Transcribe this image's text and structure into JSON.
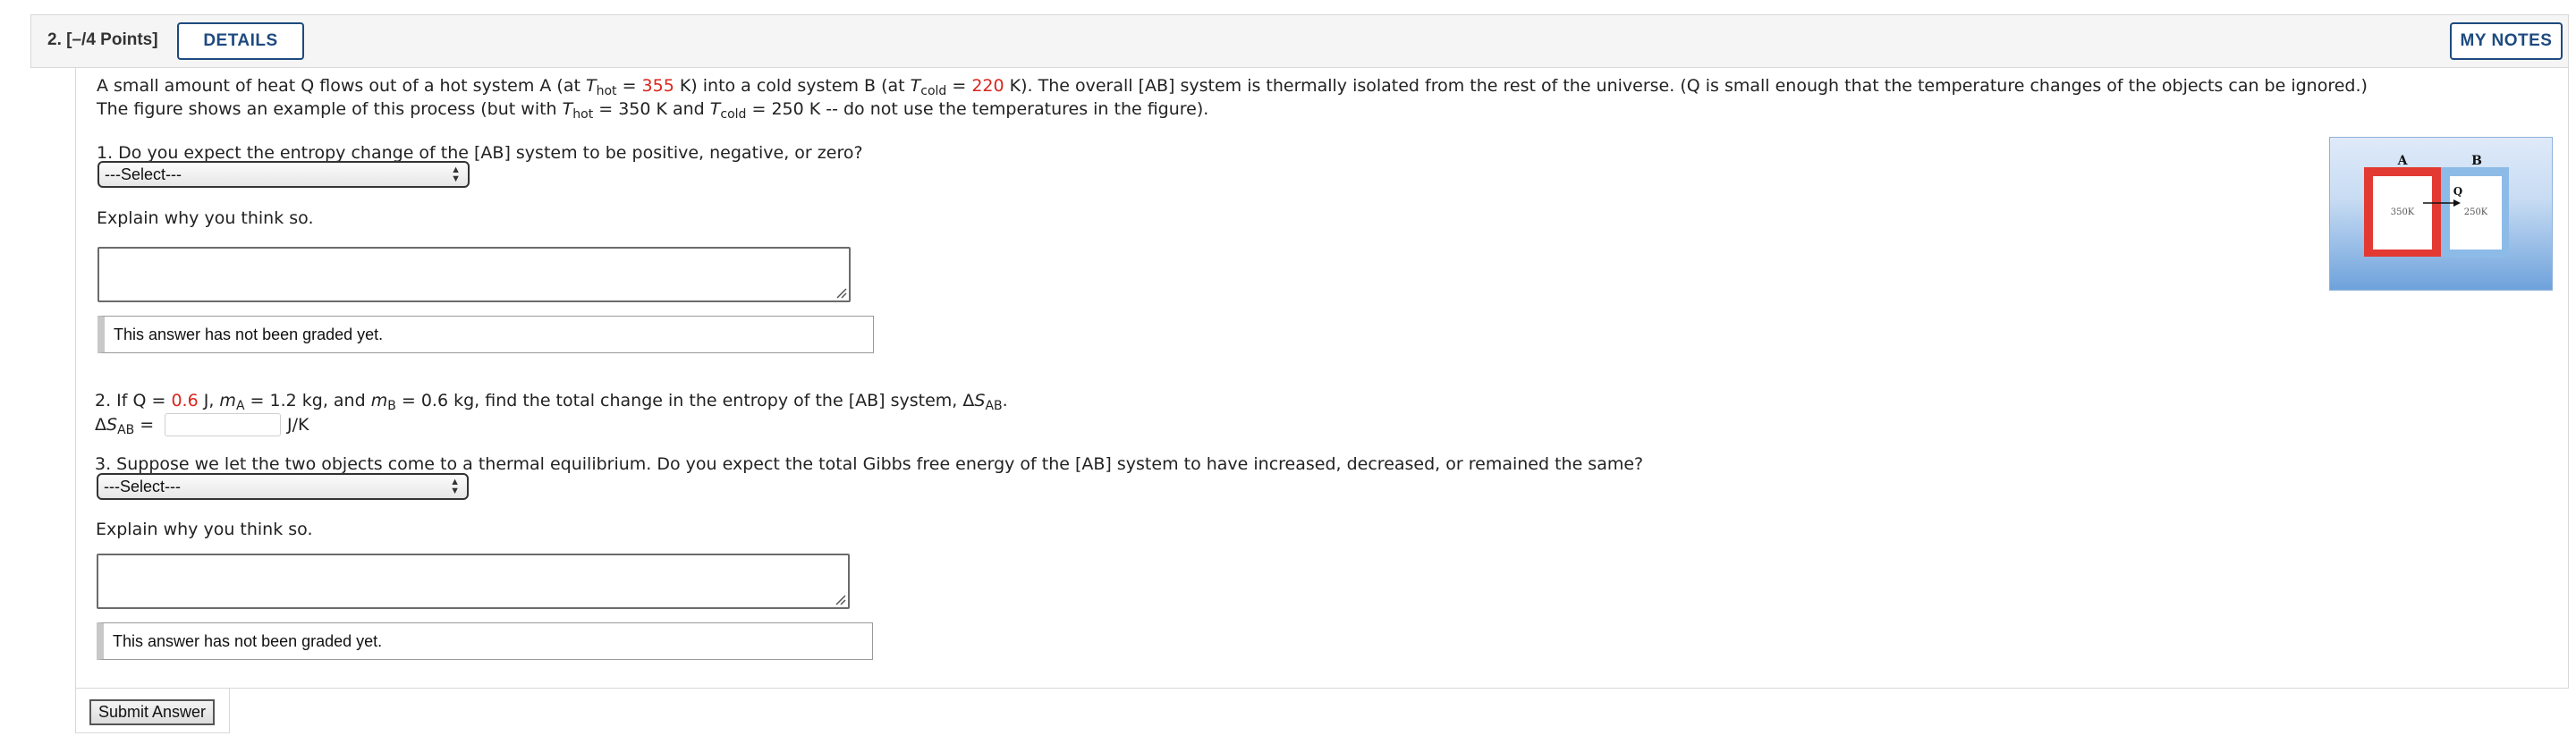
{
  "header": {
    "question_number": "2.",
    "points": "[–/4 Points]",
    "details_label": "DETAILS",
    "notes_label": "MY NOTES"
  },
  "intro": {
    "t_hot": "355",
    "t_cold": "220",
    "fig_t_hot": "350",
    "fig_t_cold": "250"
  },
  "part1": {
    "question": "1. Do you expect the entropy change of the [AB] system to be positive, negative, or zero?",
    "select_value": "---Select---",
    "explain_label": "Explain why you think so.",
    "graded_text": "This answer has not been graded yet."
  },
  "part2": {
    "q_value": "0.6",
    "ma": "1.2",
    "mb": "0.6",
    "unit": "J/K"
  },
  "part3": {
    "question": "3. Suppose we let the two objects come to a thermal equilibrium. Do you expect the total Gibbs free energy of the [AB] system to have increased, decreased, or remained the same?",
    "select_value": "---Select---",
    "explain_label": "Explain why you think so.",
    "graded_text": "This answer has not been graded yet."
  },
  "figure": {
    "label_a": "A",
    "label_b": "B",
    "label_q": "Q",
    "temp_a": "350K",
    "temp_b": "250K"
  },
  "submit_label": "Submit Answer",
  "colors": {
    "accent": "#1e4a80",
    "highlight": "#d8261c",
    "hot_wall": "#e23a32",
    "cold_wall": "#8dbbe8"
  }
}
